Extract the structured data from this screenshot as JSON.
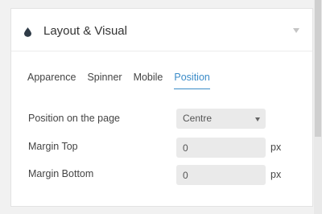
{
  "panel": {
    "title": "Layout & Visual",
    "icon": "drop-icon",
    "collapse_icon": "triangle-down-icon"
  },
  "tabs": [
    {
      "label": "Apparence",
      "active": false
    },
    {
      "label": "Spinner",
      "active": false
    },
    {
      "label": "Mobile",
      "active": false
    },
    {
      "label": "Position",
      "active": true
    }
  ],
  "fields": {
    "position": {
      "label": "Position on the page",
      "value": "Centre"
    },
    "margin_top": {
      "label": "Margin Top",
      "value": "0",
      "unit": "px"
    },
    "margin_bottom": {
      "label": "Margin Bottom",
      "value": "0",
      "unit": "px"
    }
  },
  "colors": {
    "accent": "#3a8bc8",
    "icon": "#2f3b47"
  }
}
